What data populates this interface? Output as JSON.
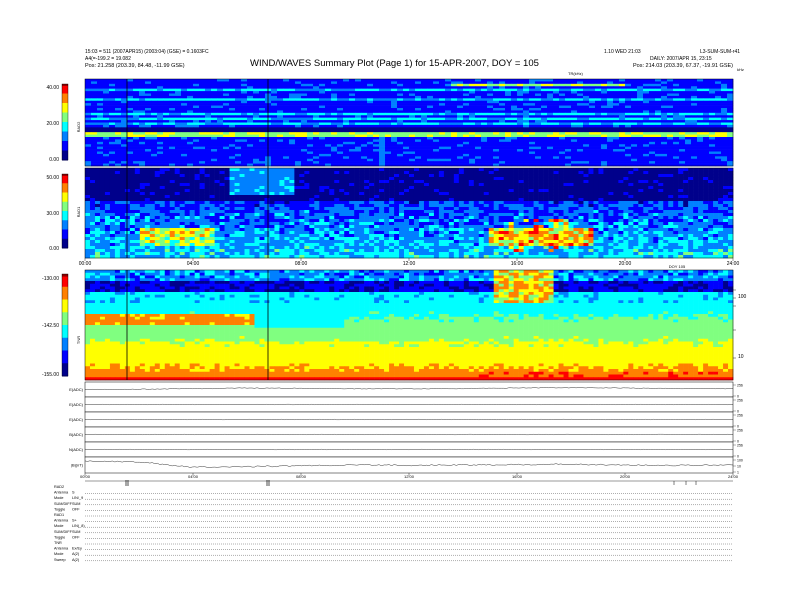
{
  "header": {
    "title": "WIND/WAVES Summary Plot (Page 1) for 15-APR-2007, DOY = 105",
    "left_line1": "15:03 = 511 (2007APR15) (2003:04) (GSE) = 0.1603FC",
    "left_line2": "A4(=-199.2 = 19.082",
    "left_pos": "Pos:   21.258 (203.39, 84.48, -11.99 GSE)",
    "right_line1": "1.10 WED 21:03",
    "right_line2": "L3-SUM-SUM-r41",
    "right_line3": "DAILY: 2007/APR 15, 23:15",
    "right_pos": "Pos:   214.03 (203.39, 67.37, -19.91 GSE)",
    "rad2_label": "TR(kHz)",
    "tnr_right_top": "kHz"
  },
  "chart_data": [
    {
      "type": "heatmap",
      "name": "RAD2",
      "ylabel": "RAD2",
      "yticks": [
        "40.00",
        "20.00",
        "0.00"
      ],
      "ylim": [
        0,
        40
      ]
    },
    {
      "type": "heatmap",
      "name": "RAD1",
      "ylabel": "RAD1",
      "yticks": [
        "50.00",
        "30.00",
        "0.00"
      ],
      "ylim": [
        0,
        50
      ],
      "xticks": [
        "00:00",
        "04:00",
        "08:00",
        "12:00",
        "16:00",
        "20:00",
        "24:00"
      ],
      "xunit": "DOY 105"
    },
    {
      "type": "heatmap",
      "name": "TNR",
      "ylabel": "TNR",
      "yticks": [
        "-130.00",
        "-142.50",
        "-155.00"
      ],
      "ylim": [
        -155,
        -130
      ],
      "right_ticks": [
        "100",
        "10"
      ]
    },
    {
      "type": "line",
      "name": "E/B field traces",
      "series": [
        {
          "name": "E(ADC)",
          "values": [
            0.5,
            0.52,
            0.55,
            0.6,
            0.58,
            0.55,
            0.55,
            0.56,
            0.6,
            0.62,
            0.6,
            0.56,
            0.55
          ]
        },
        {
          "name": "E(ADC)",
          "values": [
            0.5,
            0.5,
            0.5,
            0.5,
            0.5,
            0.5,
            0.5,
            0.5,
            0.5,
            0.5,
            0.5,
            0.5,
            0.5
          ]
        },
        {
          "name": "E(ADC)",
          "values": [
            0.5,
            0.5,
            0.5,
            0.5,
            0.5,
            0.5,
            0.5,
            0.5,
            0.5,
            0.5,
            0.5,
            0.5,
            0.5
          ]
        },
        {
          "name": "B(ADC)",
          "values": [
            0.5,
            0.5,
            0.5,
            0.5,
            0.5,
            0.5,
            0.5,
            0.5,
            0.5,
            0.5,
            0.5,
            0.5,
            0.5
          ]
        },
        {
          "name": "N(ADC)",
          "values": [
            0.5,
            0.5,
            0.5,
            0.5,
            0.5,
            0.5,
            0.5,
            0.5,
            0.5,
            0.5,
            0.5,
            0.5,
            0.5
          ]
        },
        {
          "name": "|B|(nT)",
          "values": [
            0.75,
            0.7,
            0.35,
            0.4,
            0.45,
            0.5,
            0.48,
            0.5,
            0.52,
            0.55,
            0.5,
            0.48,
            0.5
          ]
        }
      ],
      "right_ticks": [
        [
          "256",
          "0"
        ],
        [
          "256",
          "0"
        ],
        [
          "256",
          "0"
        ],
        [
          "256",
          "0"
        ],
        [
          "256",
          "0"
        ],
        [
          "100",
          "10",
          "1"
        ]
      ],
      "xticks": [
        "00:00",
        "04:00",
        "08:00",
        "12:00",
        "16:00",
        "20:00",
        "24:00"
      ]
    }
  ],
  "footer": {
    "rows": [
      [
        "RAD2",
        ""
      ],
      [
        "Antenna",
        "S"
      ],
      [
        "Mode",
        "LIN/_9"
      ],
      [
        "SUM/DIFF",
        "SUM"
      ],
      [
        "Toggle",
        "OFF"
      ],
      [
        "RAD1",
        ""
      ],
      [
        "Antenna",
        "S+"
      ],
      [
        "Mode",
        "LIN(_8)"
      ],
      [
        "SUM/DIFF",
        "SUM"
      ],
      [
        "Toggle",
        "OFF"
      ],
      [
        "TNR",
        ""
      ],
      [
        "Antenna",
        "Ex/Ey"
      ],
      [
        "Mode",
        "A(2)"
      ],
      [
        "Sweep",
        "A(2)"
      ]
    ]
  },
  "colors": {
    "cmap": [
      "#00008b",
      "#0000ff",
      "#0080ff",
      "#00ffff",
      "#80ff80",
      "#ffff00",
      "#ff8000",
      "#ff0000",
      "#8b0000"
    ]
  }
}
